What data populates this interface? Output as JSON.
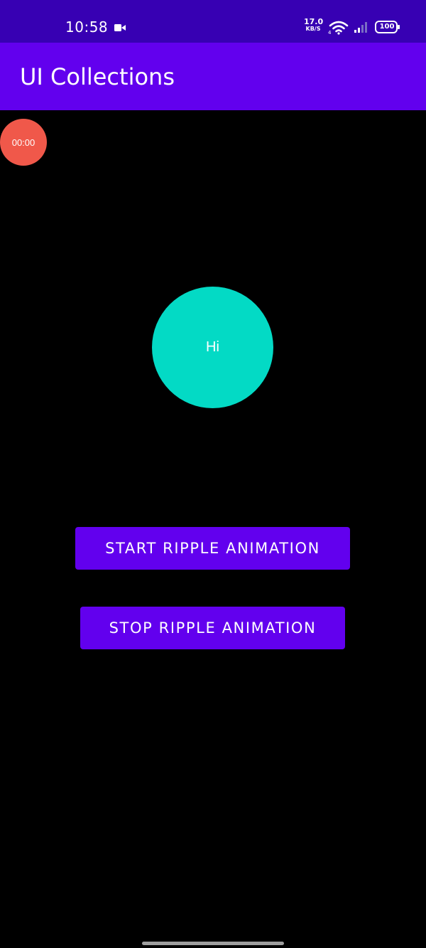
{
  "status_bar": {
    "time": "10:58",
    "network_speed_value": "17.0",
    "network_speed_unit": "KB/S",
    "battery_level": "100",
    "icons": [
      "video-icon",
      "wifi-icon",
      "signal-icon",
      "battery-icon"
    ]
  },
  "app_bar": {
    "title": "UI Collections"
  },
  "timer": {
    "text": "00:00"
  },
  "ripple": {
    "text": "Hi"
  },
  "buttons": {
    "start_label": "START RIPPLE ANIMATION",
    "stop_label": "STOP RIPPLE ANIMATION"
  },
  "colors": {
    "status_bar": "#3700B3",
    "primary": "#6200EE",
    "teal": "#03DAC5",
    "timer": "#F0584A",
    "background": "#000000"
  }
}
